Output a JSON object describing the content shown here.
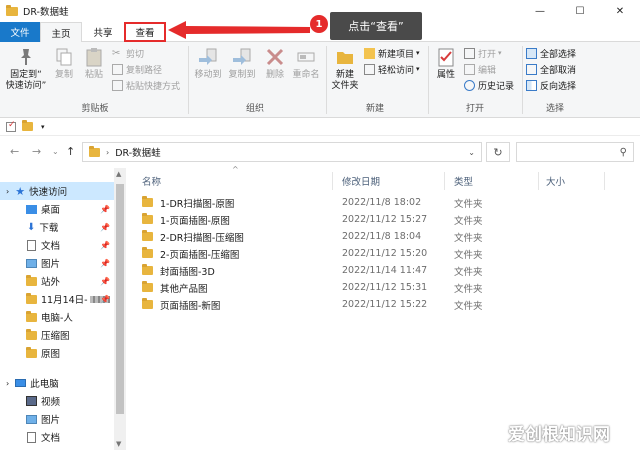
{
  "window": {
    "title": "DR-数据蛙",
    "controls": [
      "—",
      "☐",
      "✕"
    ]
  },
  "tabs": [
    "文件",
    "主页",
    "共享",
    "查看"
  ],
  "annotation": {
    "step": "1",
    "text": "点击“查看”"
  },
  "ribbon": {
    "clipboard": {
      "label": "剪贴板",
      "pin": "固定到“\n快速访问”",
      "copy": "复制",
      "paste": "粘贴",
      "cut": "剪切",
      "copy_path": "复制路径",
      "paste_shortcut": "粘贴快捷方式"
    },
    "organize": {
      "label": "组织",
      "move_to": "移动到",
      "copy_to": "复制到",
      "delete": "删除",
      "rename": "重命名"
    },
    "new": {
      "label": "新建",
      "new_folder": "新建\n文件夹",
      "new_item": "新建项目",
      "easy_access": "轻松访问"
    },
    "open": {
      "label": "打开",
      "properties": "属性",
      "open": "打开",
      "edit": "编辑",
      "history": "历史记录"
    },
    "select": {
      "label": "选择",
      "select_all": "全部选择",
      "select_none": "全部取消",
      "invert": "反向选择"
    }
  },
  "address": {
    "path": "DR-数据蛙",
    "search_placeholder": ""
  },
  "columns": {
    "name": "名称",
    "date": "修改日期",
    "type": "类型",
    "size": "大小"
  },
  "files": [
    {
      "name": "1-DR扫描图-原图",
      "date": "2022/11/8 18:02",
      "type": "文件夹"
    },
    {
      "name": "1-页面插图-原图",
      "date": "2022/11/12 15:27",
      "type": "文件夹"
    },
    {
      "name": "2-DR扫描图-压缩图",
      "date": "2022/11/8 18:04",
      "type": "文件夹"
    },
    {
      "name": "2-页面插图-压缩图",
      "date": "2022/11/12 15:20",
      "type": "文件夹"
    },
    {
      "name": "封面插图-3D",
      "date": "2022/11/14 11:47",
      "type": "文件夹"
    },
    {
      "name": "其他产品图",
      "date": "2022/11/12 15:31",
      "type": "文件夹"
    },
    {
      "name": "页面插图-新图",
      "date": "2022/11/12 15:22",
      "type": "文件夹"
    }
  ],
  "navpane": {
    "quick_access": "快速访问",
    "items": [
      {
        "label": "桌面",
        "pinned": true
      },
      {
        "label": "下载",
        "pinned": true
      },
      {
        "label": "文档",
        "pinned": true
      },
      {
        "label": "图片",
        "pinned": true
      },
      {
        "label": "站外",
        "pinned": true
      },
      {
        "label": "11月14日-",
        "pinned": true
      },
      {
        "label": "电脑-人",
        "pinned": false
      },
      {
        "label": "压缩图",
        "pinned": false
      },
      {
        "label": "原图",
        "pinned": false
      }
    ],
    "this_pc": "此电脑",
    "pc_items": [
      "视频",
      "图片",
      "文档"
    ]
  },
  "watermark": "爱创根知识网",
  "colors": {
    "file_tab": "#1979ca",
    "highlight": "#e52b2b",
    "folder": "#e8b53e",
    "selection": "#cce8ff"
  }
}
